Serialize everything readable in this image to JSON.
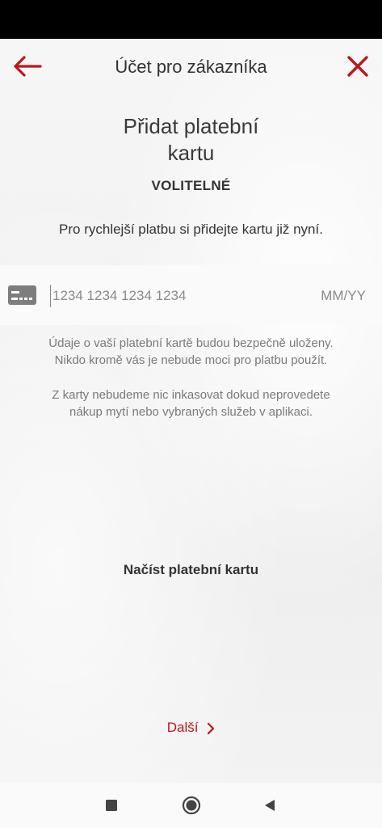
{
  "header": {
    "title": "Účet pro zákazníka",
    "back_icon": "arrow-left-icon",
    "close_icon": "close-icon",
    "accent_color": "#c0141b"
  },
  "main": {
    "heading_line1": "Přidat platební",
    "heading_line2": "kartu",
    "optional_label": "VOLITELNÉ",
    "subtitle": "Pro rychlejší platbu si přidejte kartu již nyní.",
    "card_number_placeholder": "1234 1234 1234 1234",
    "expiry_placeholder": "MM/YY",
    "card_icon": "credit-card-icon",
    "note1_line1": "Údaje o vaší platební kartě budou bezpečně uloženy.",
    "note1_line2": "Nikdo kromě vás je nebude moci pro platbu použít.",
    "note2_line1": "Z karty nebudeme nic inkasovat dokud neprovedete",
    "note2_line2": "nákup mytí nebo vybraných služeb v aplikaci.",
    "scan_card_label": "Načíst platební kartu",
    "next_label": "Další"
  },
  "navbar": {
    "recents_icon": "square-icon",
    "home_icon": "circle-icon",
    "back_icon": "triangle-back-icon"
  }
}
